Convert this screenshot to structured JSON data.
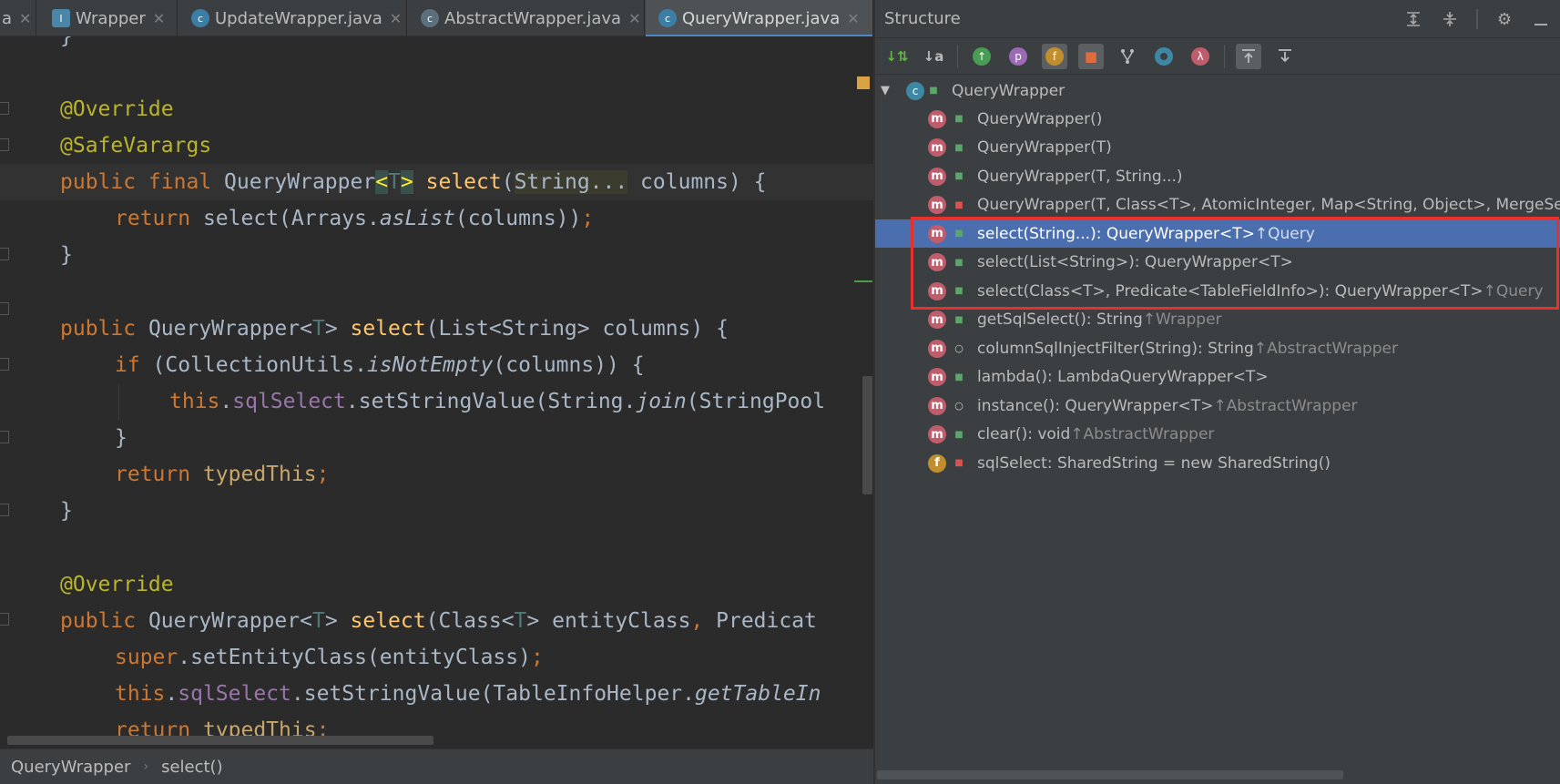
{
  "tabs": [
    {
      "label": "a",
      "icon": "",
      "active": false
    },
    {
      "label": "Wrapper",
      "icon": "interface-icon",
      "active": false
    },
    {
      "label": "UpdateWrapper.java",
      "icon": "class-icon",
      "active": false
    },
    {
      "label": "AbstractWrapper.java",
      "icon": "abstract-class-icon",
      "active": false
    },
    {
      "label": "QueryWrapper.java",
      "icon": "class-icon",
      "active": true
    }
  ],
  "editor": {
    "lines": {
      "l0": "}",
      "l2": "@Override",
      "l3": "@SafeVarargs",
      "l4_kw": "public final ",
      "l4_type": "QueryWrapper",
      "l4_lt": "<",
      "l4_t": "T",
      "l4_gt": ">",
      "l4_fn": "select",
      "l4_p1": "(",
      "l4_param": "String...",
      "l4_rest": " columns) {",
      "l5_kw": "return ",
      "l5_a": "select(Arrays.",
      "l5_it": "asList",
      "l5_b": "(columns))",
      "l5_semi": ";",
      "l6": "}",
      "l8_kw": "public ",
      "l8_a": "QueryWrapper<",
      "l8_t": "T",
      "l8_b": "> ",
      "l8_fn": "select",
      "l8_c": "(List<String> columns) {",
      "l9_kw": "if ",
      "l9_a": "(CollectionUtils.",
      "l9_it": "isNotEmpty",
      "l9_b": "(columns)) {",
      "l10_kw": "this",
      "l10_a": ".",
      "l10_fd": "sqlSelect",
      "l10_b": ".setStringValue(String.",
      "l10_it": "join",
      "l10_c": "(StringPool",
      "l11": "}",
      "l12_kw": "return ",
      "l12_b": "typedThis",
      "l12_semi": ";",
      "l13": "}",
      "l15": "@Override",
      "l16_kw": "public ",
      "l16_a": "QueryWrapper<",
      "l16_t": "T",
      "l16_b": "> ",
      "l16_fn": "select",
      "l16_c": "(Class<",
      "l16_t2": "T",
      "l16_d": "> entityClass",
      "l16_comma": ", ",
      "l16_e": "Predicat",
      "l17_kw": "super",
      "l17_a": ".setEntityClass(entityClass)",
      "l17_semi": ";",
      "l18_kw": "this",
      "l18_a": ".",
      "l18_fd": "sqlSelect",
      "l18_b": ".setStringValue(TableInfoHelper.",
      "l18_it": "getTableIn",
      "l19_kw": "return ",
      "l19_b": "typedThis",
      "l19_semi": ";"
    }
  },
  "statusbar": {
    "crumb1": "QueryWrapper",
    "separator": "›",
    "crumb2": "select()"
  },
  "structure": {
    "title": "Structure",
    "header_icons": [
      "expand-all-icon",
      "collapse-all-icon",
      "gear-icon",
      "minimize-icon"
    ],
    "toolbar": {
      "sort_visibility": "↓⇅",
      "sort_alpha": "↓a",
      "props_letter": "p",
      "fields_letter": "f",
      "lambda_letter": "λ"
    },
    "root": "QueryWrapper",
    "items": [
      {
        "kind": "m",
        "vis": "pub",
        "text": "QueryWrapper()",
        "inh": ""
      },
      {
        "kind": "m",
        "vis": "pub",
        "text": "QueryWrapper(T)",
        "inh": ""
      },
      {
        "kind": "m",
        "vis": "pub",
        "text": "QueryWrapper(T, String...)",
        "inh": ""
      },
      {
        "kind": "m",
        "vis": "priv",
        "text": "QueryWrapper(T, Class<T>, AtomicInteger, Map<String, Object>, MergeSe",
        "inh": ""
      },
      {
        "kind": "m",
        "vis": "pub",
        "text": "select(String...): QueryWrapper<T>",
        "inh": "↑Query"
      },
      {
        "kind": "m",
        "vis": "pub",
        "text": "select(List<String>): QueryWrapper<T>",
        "inh": ""
      },
      {
        "kind": "m",
        "vis": "pub",
        "text": "select(Class<T>, Predicate<TableFieldInfo>): QueryWrapper<T>",
        "inh": "↑Query"
      },
      {
        "kind": "m",
        "vis": "pub",
        "text": "getSqlSelect(): String",
        "inh": "↑Wrapper"
      },
      {
        "kind": "m",
        "vis": "prot",
        "text": "columnSqlInjectFilter(String): String",
        "inh": "↑AbstractWrapper"
      },
      {
        "kind": "m",
        "vis": "pub",
        "text": "lambda(): LambdaQueryWrapper<T>",
        "inh": ""
      },
      {
        "kind": "m",
        "vis": "prot",
        "text": "instance(): QueryWrapper<T>",
        "inh": "↑AbstractWrapper"
      },
      {
        "kind": "m",
        "vis": "pub",
        "text": "clear(): void",
        "inh": "↑AbstractWrapper"
      },
      {
        "kind": "f",
        "vis": "priv",
        "text": "sqlSelect: SharedString = new SharedString()",
        "inh": ""
      }
    ],
    "selected_index": 4,
    "icon_letters": {
      "method": "m",
      "field": "f",
      "class": "c"
    }
  }
}
